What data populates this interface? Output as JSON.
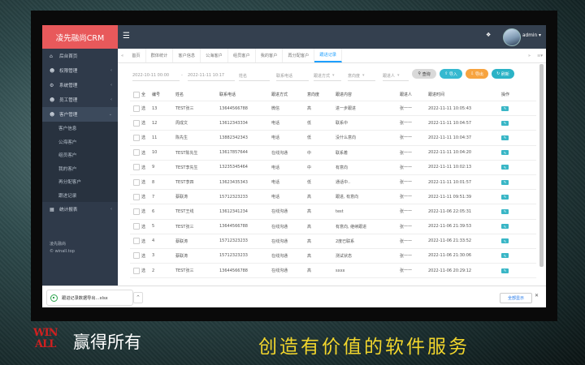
{
  "app": {
    "title": "凌先融尚CRM",
    "user": "admin ▾"
  },
  "sidebar": {
    "items": [
      {
        "label": "后台首页",
        "icon": "home-icon",
        "glyph": "⌂"
      },
      {
        "label": "权限管理",
        "icon": "users-icon",
        "glyph": "☻",
        "arrow": "‹"
      },
      {
        "label": "系统管理",
        "icon": "gear-icon",
        "glyph": "⚙",
        "arrow": "‹"
      },
      {
        "label": "员工管理",
        "icon": "staff-icon",
        "glyph": "☻",
        "arrow": "‹"
      },
      {
        "label": "客户管理",
        "icon": "customer-icon",
        "glyph": "☻",
        "arrow": "⌄"
      }
    ],
    "subitems": [
      "客户信息",
      "公海客户",
      "组员客户",
      "我的客户",
      "再分配客户",
      "跟进记录"
    ],
    "stats": {
      "label": "统计报表",
      "icon": "grid-icon",
      "glyph": "▦",
      "arrow": "‹"
    },
    "footer": [
      "凌先融尚",
      "© winall.top"
    ]
  },
  "tabs": [
    "首页",
    "群体统计",
    "客户信息",
    "公海客户",
    "组员客户",
    "我的客户",
    "再分配客户",
    "跟进记录"
  ],
  "filters": {
    "date_start": "2022-10-11 00:00",
    "date_end": "2022-11-11 10:17",
    "name_placeholder": "姓名",
    "phone_placeholder": "联系电话",
    "method": "跟进方式",
    "intent": "意向度",
    "follower": "跟进人",
    "search": "查询",
    "import": "导入",
    "export": "导出",
    "refresh": "刷新"
  },
  "table": {
    "headers": [
      "全",
      "编号",
      "姓名",
      "联系电话",
      "跟进方式",
      "意向度",
      "跟进内容",
      "跟进人",
      "跟进时间",
      "操作"
    ],
    "select_label": "选",
    "rows": [
      [
        "13",
        "TEST张三",
        "13644566788",
        "微信",
        "高",
        "进一步跟进",
        "张一一",
        "2022-11-11 10:05:43"
      ],
      [
        "12",
        "周成文",
        "13612343334",
        "电话",
        "低",
        "联系中",
        "张一一",
        "2022-11-11 10:04:57"
      ],
      [
        "11",
        "陈先生",
        "13882342343",
        "电话",
        "低",
        "没什么意向",
        "张一一",
        "2022-11-11 10:04:37"
      ],
      [
        "10",
        "TEST陈先生",
        "13617857644",
        "在线沟通",
        "中",
        "联系着",
        "张一一",
        "2022-11-11 10:04:20"
      ],
      [
        "9",
        "TEST李先生",
        "13235345464",
        "电话",
        "中",
        "有意向",
        "张一一",
        "2022-11-11 10:02:13"
      ],
      [
        "8",
        "TEST李四",
        "13623435343",
        "电话",
        "低",
        "通话中..",
        "张一一",
        "2022-11-11 10:01:57"
      ],
      [
        "7",
        "蔡联涛",
        "15712323233",
        "电话",
        "高",
        "跟进, 有意向",
        "张一一",
        "2022-11-11 09:51:39"
      ],
      [
        "6",
        "TEST王线",
        "13612341234",
        "在线沟通",
        "高",
        "test",
        "张一一",
        "2022-11-06 22:05:31"
      ],
      [
        "5",
        "TEST张三",
        "13644566788",
        "在线沟通",
        "高",
        "有意向, 继续跟进",
        "张一一",
        "2022-11-06 21:39:53"
      ],
      [
        "4",
        "蔡联涛",
        "15712323233",
        "在线沟通",
        "高",
        "2度已联系",
        "张一一",
        "2022-11-06 21:33:52"
      ],
      [
        "3",
        "蔡联涛",
        "15712323233",
        "在线沟通",
        "高",
        "测试状态",
        "张一一",
        "2022-11-06 21:30:06"
      ],
      [
        "2",
        "TEST张三",
        "13644566788",
        "在线沟通",
        "高",
        "sxxx",
        "张一一",
        "2022-11-06 20:29:12"
      ]
    ]
  },
  "download": {
    "file": "跟进记录数据导出...xlsx",
    "caret": "^",
    "show_all": "全部显示",
    "close": "✕"
  },
  "banner": {
    "logo": [
      "WIN",
      "ALL"
    ],
    "left": "赢得所有",
    "right": "创造有价值的软件服务"
  },
  "colors": {
    "sidebar": "#2f3a4a",
    "logo_bg": "#e8595b",
    "search": "#d9d9d9",
    "import": "#36b9d0",
    "export": "#f7a440",
    "refresh": "#2bb3c6"
  }
}
